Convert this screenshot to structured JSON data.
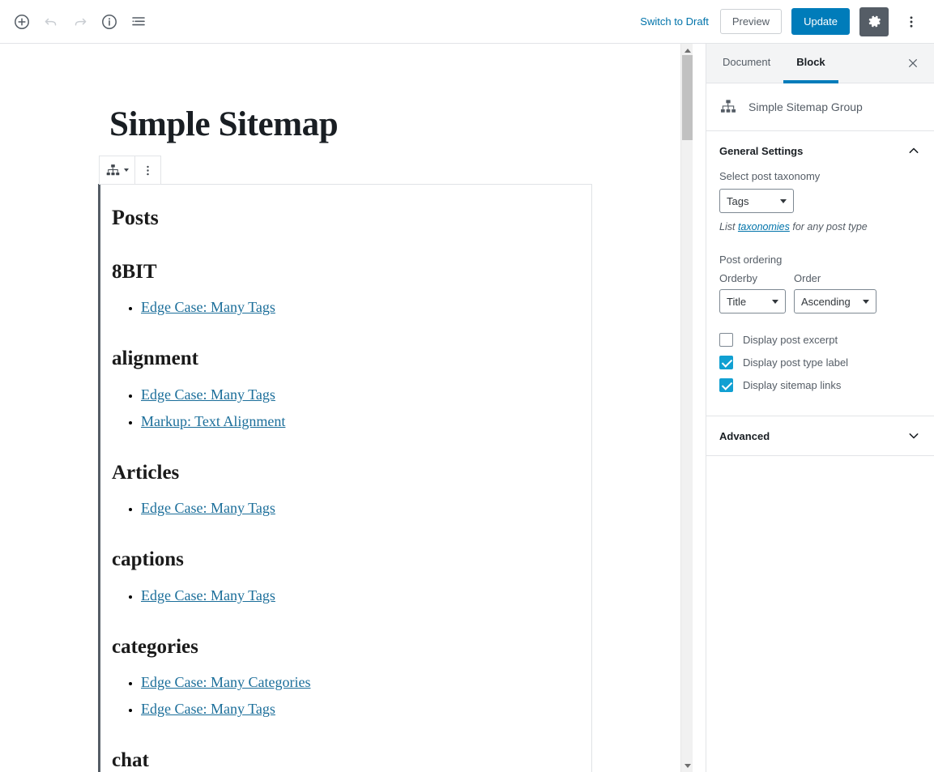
{
  "header": {
    "tools": [
      {
        "name": "add-block-icon",
        "label": "Add block"
      },
      {
        "name": "undo-icon",
        "label": "Undo"
      },
      {
        "name": "redo-icon",
        "label": "Redo"
      },
      {
        "name": "content-info-icon",
        "label": "Content structure"
      },
      {
        "name": "block-navigation-icon",
        "label": "Block navigation"
      }
    ],
    "switch_to_draft": "Switch to Draft",
    "preview": "Preview",
    "update": "Update",
    "settings_icon": "gear-icon",
    "more_icon": "ellipsis-vertical-icon"
  },
  "editor": {
    "post_title": "Simple Sitemap",
    "block_toolbar": {
      "block_type_icon": "sitemap-icon",
      "more_options_icon": "ellipsis-vertical-icon"
    },
    "sitemap": {
      "root_heading": "Posts",
      "groups": [
        {
          "term": "8BIT",
          "links": [
            "Edge Case: Many Tags"
          ]
        },
        {
          "term": "alignment",
          "links": [
            "Edge Case: Many Tags",
            "Markup: Text Alignment"
          ]
        },
        {
          "term": "Articles",
          "links": [
            "Edge Case: Many Tags"
          ]
        },
        {
          "term": "captions",
          "links": [
            "Edge Case: Many Tags"
          ]
        },
        {
          "term": "categories",
          "links": [
            "Edge Case: Many Categories",
            "Edge Case: Many Tags"
          ]
        },
        {
          "term": "chat",
          "links": []
        }
      ]
    }
  },
  "sidebar": {
    "tabs": [
      {
        "label": "Document",
        "active": false
      },
      {
        "label": "Block",
        "active": true
      }
    ],
    "close_icon": "close-icon",
    "block_card": {
      "icon": "sitemap-icon",
      "name": "Simple Sitemap Group"
    },
    "panels": [
      {
        "title": "General Settings",
        "expanded": true,
        "chevron": "chevron-up-icon"
      },
      {
        "title": "Advanced",
        "expanded": false,
        "chevron": "chevron-down-icon"
      }
    ],
    "general": {
      "taxonomy_label": "Select post taxonomy",
      "taxonomy_value": "Tags",
      "taxonomy_help_prefix": "List ",
      "taxonomy_help_link": "taxonomies",
      "taxonomy_help_suffix": " for any post type",
      "ordering_label": "Post ordering",
      "orderby_label": "Orderby",
      "orderby_value": "Title",
      "order_label": "Order",
      "order_value": "Ascending",
      "checkboxes": [
        {
          "label": "Display post excerpt",
          "checked": false
        },
        {
          "label": "Display post type label",
          "checked": true
        },
        {
          "label": "Display sitemap links",
          "checked": true
        }
      ]
    }
  },
  "colors": {
    "accent_blue": "#007cba",
    "link_blue": "#0073aa",
    "checkbox_blue": "#11a0d2",
    "sitemap_link": "#1b6e9a",
    "toolbar_gray": "#555d66"
  }
}
